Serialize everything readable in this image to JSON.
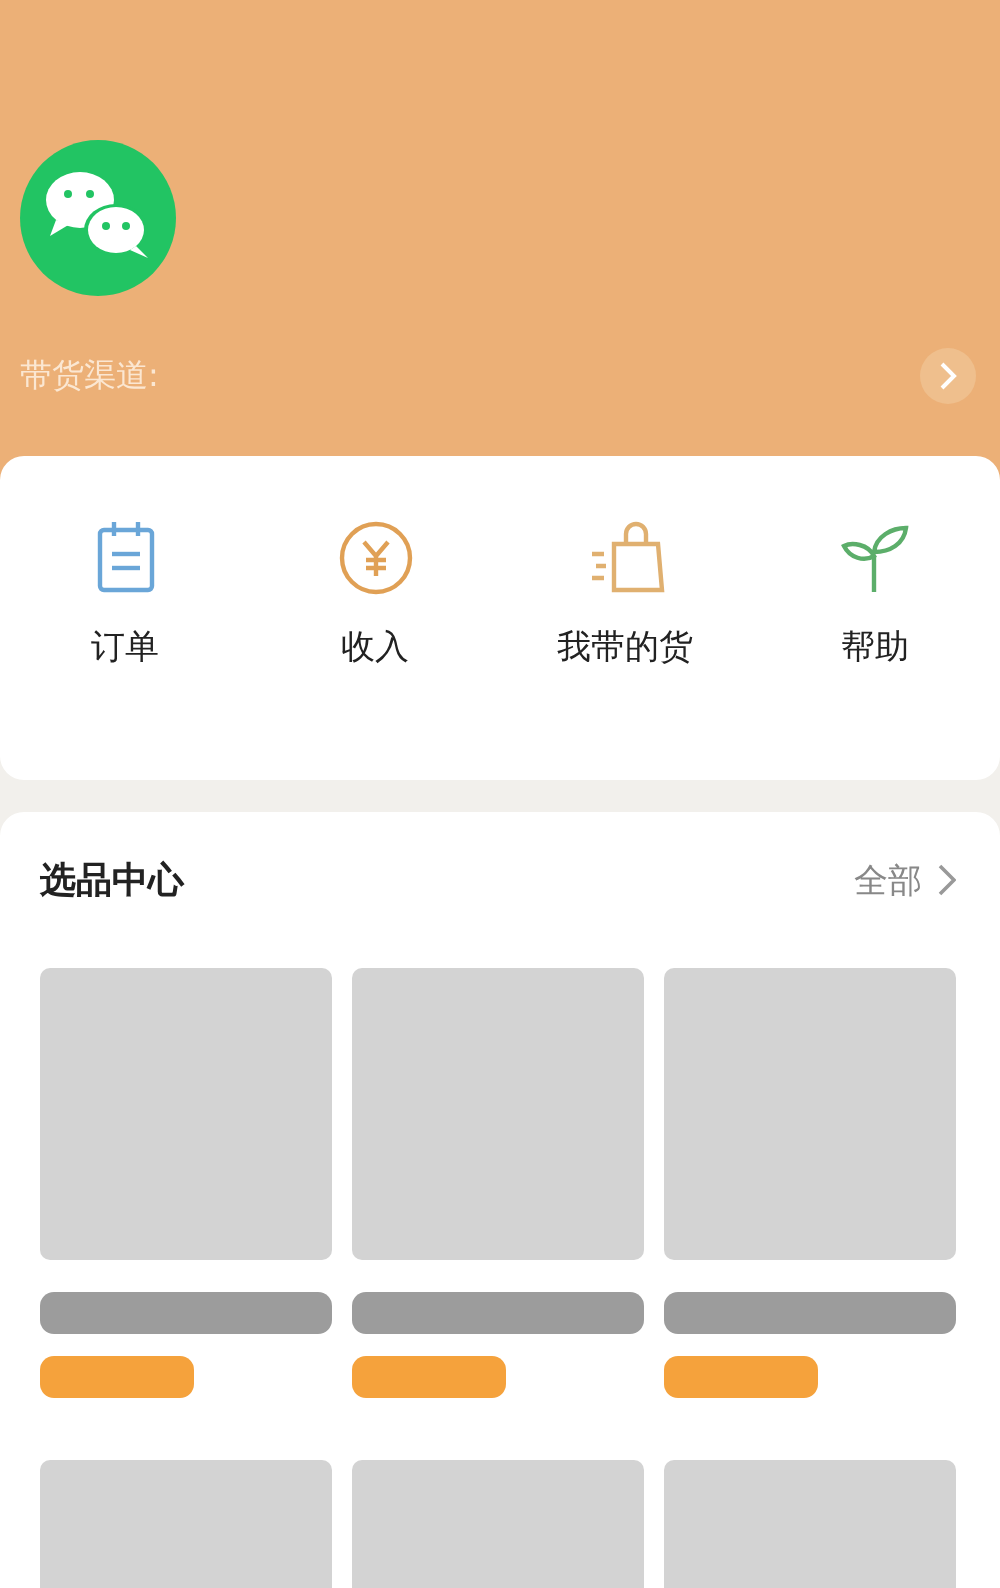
{
  "header": {
    "avatar": {
      "kind": "chat-logo"
    },
    "channel_label": "带货渠道:"
  },
  "actions": [
    {
      "label": "订单",
      "kind": "notepad"
    },
    {
      "label": "收入",
      "kind": "yen"
    },
    {
      "label": "我带的货",
      "kind": "bag"
    },
    {
      "label": "帮助",
      "kind": "sprout"
    }
  ],
  "selection_center": {
    "title": "选品中心",
    "more_link": "全部",
    "products": [
      {
        "kind": "skeleton"
      },
      {
        "kind": "skeleton"
      },
      {
        "kind": "skeleton"
      },
      {
        "kind": "image-only"
      },
      {
        "kind": "image-only"
      },
      {
        "kind": "image-only"
      }
    ]
  }
}
